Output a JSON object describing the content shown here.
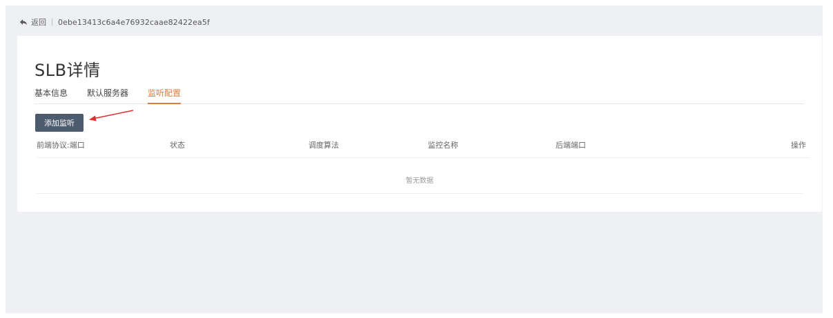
{
  "header": {
    "back_label": "返回",
    "instance_id": "0ebe13413c6a4e76932caae82422ea5f"
  },
  "page": {
    "title": "SLB详情"
  },
  "tabs": [
    {
      "label": "基本信息",
      "active": false
    },
    {
      "label": "默认服务器",
      "active": false
    },
    {
      "label": "监听配置",
      "active": true
    }
  ],
  "toolbar": {
    "add_listener_label": "添加监听"
  },
  "table": {
    "columns": [
      "前端协议:端口",
      "状态",
      "调度算法",
      "监控名称",
      "后端端口",
      "操作"
    ],
    "empty_text": "暂无数据"
  },
  "colors": {
    "accent": "#e07b3a",
    "button": "#4d5b6f",
    "annotation": "#e0302f"
  }
}
